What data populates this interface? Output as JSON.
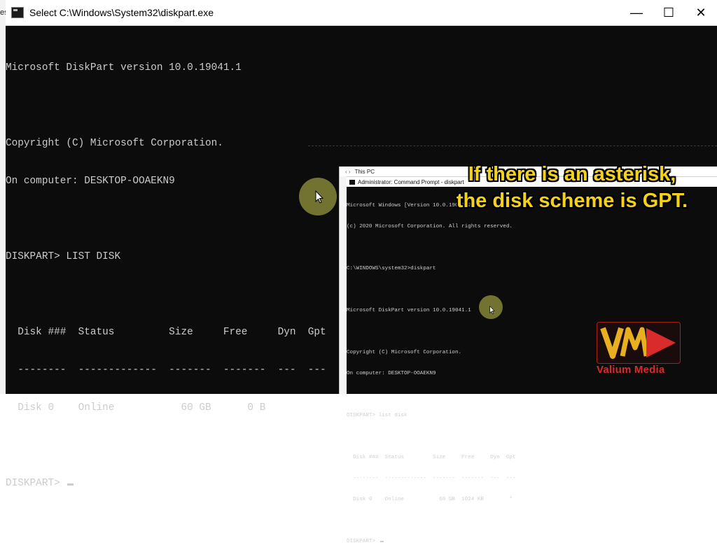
{
  "window": {
    "title": "Select C:\\Windows\\System32\\diskpart.exe",
    "controls": {
      "minimize": "—",
      "maximize": "☐",
      "close": "✕"
    }
  },
  "console": {
    "lines": [
      "Microsoft DiskPart version 10.0.19041.1",
      "",
      "Copyright (C) Microsoft Corporation.",
      "On computer: DESKTOP-OOAEKN9",
      "",
      "DISKPART> LIST DISK",
      "",
      "  Disk ###  Status         Size     Free     Dyn  Gpt",
      "  --------  -------------  -------  -------  ---  ---",
      "  Disk 0    Online           60 GB      0 B",
      ""
    ],
    "prompt": "DISKPART> "
  },
  "inset": {
    "explorer_path": "This PC",
    "cmd_title": "Administrator: Command Prompt - diskpart",
    "lines": [
      "Microsoft Windows [Version 10.0.19041.264]",
      "(c) 2020 Microsoft Corporation. All rights reserved.",
      "",
      "C:\\WINDOWS\\system32>diskpart",
      "",
      "Microsoft DiskPart version 10.0.19041.1",
      "",
      "Copyright (C) Microsoft Corporation.",
      "On computer: DESKTOP-OOAEKN9",
      "",
      "DISKPART> list disk",
      "",
      "  Disk ###  Status         Size     Free     Dyn  Gpt",
      "  --------  -------------  -------  -------  ---  ---",
      "  Disk 0    Online           60 GB  1024 KB        *",
      ""
    ],
    "prompt": "DISKPART> "
  },
  "caption": {
    "line1": "If there is an asterisk,",
    "line2": "the disk scheme is GPT."
  },
  "logo": {
    "text": "Valium Media",
    "colors": {
      "accent": "#d92b2b",
      "gold": "#e8b020"
    }
  },
  "colors": {
    "console_bg": "#0c0c0c",
    "console_fg": "#cccccc",
    "caption": "#f4d11a"
  }
}
